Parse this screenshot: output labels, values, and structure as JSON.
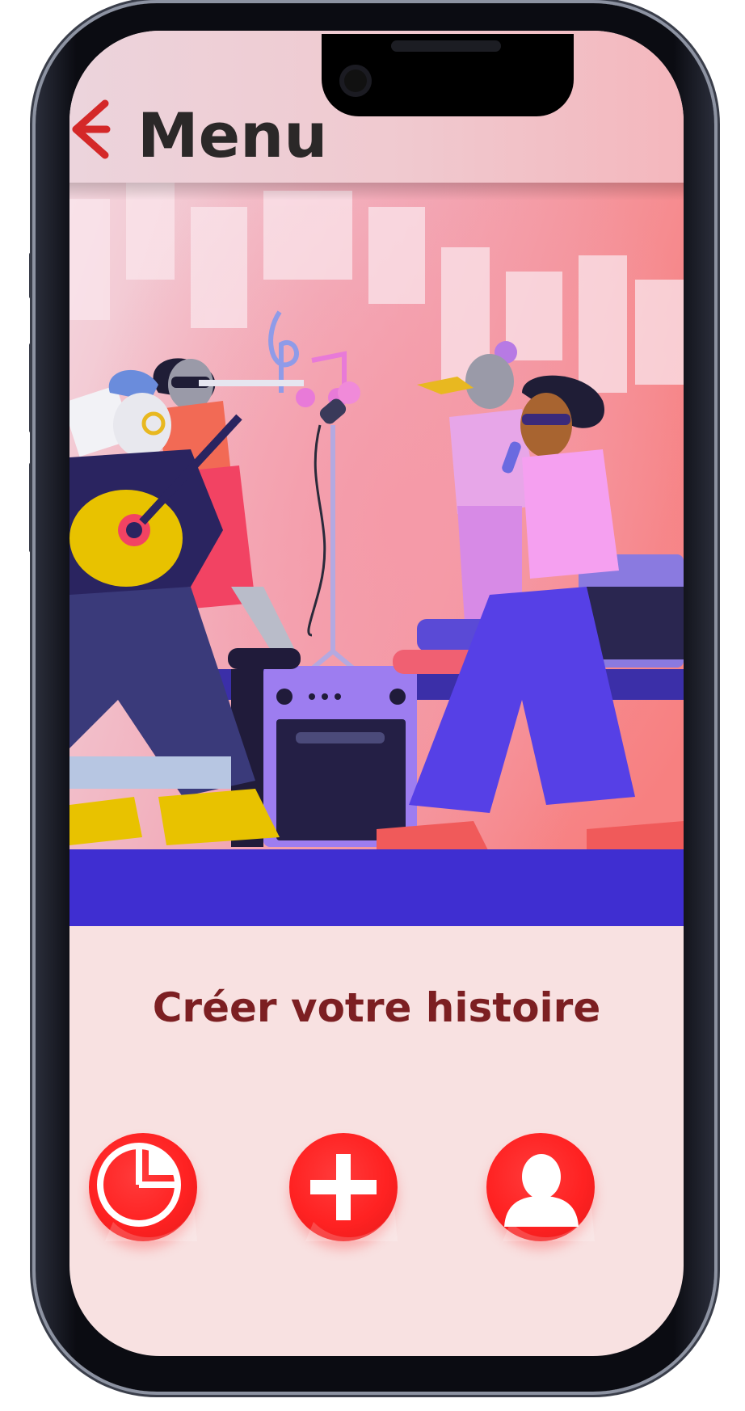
{
  "header": {
    "title": "Menu",
    "back_icon": "arrow-left-icon"
  },
  "hero": {
    "icon": "concert-band-illustration"
  },
  "cta": {
    "label": "Créer votre histoire"
  },
  "nav": [
    {
      "icon": "pie-chart-icon"
    },
    {
      "icon": "plus-icon"
    },
    {
      "icon": "user-icon"
    }
  ],
  "colors": {
    "accent": "#ff2222",
    "cta_text": "#7c1f22",
    "title_text": "#2b2828",
    "screen_bg": "#f8e1e1",
    "stage": "#3f2ed1"
  }
}
